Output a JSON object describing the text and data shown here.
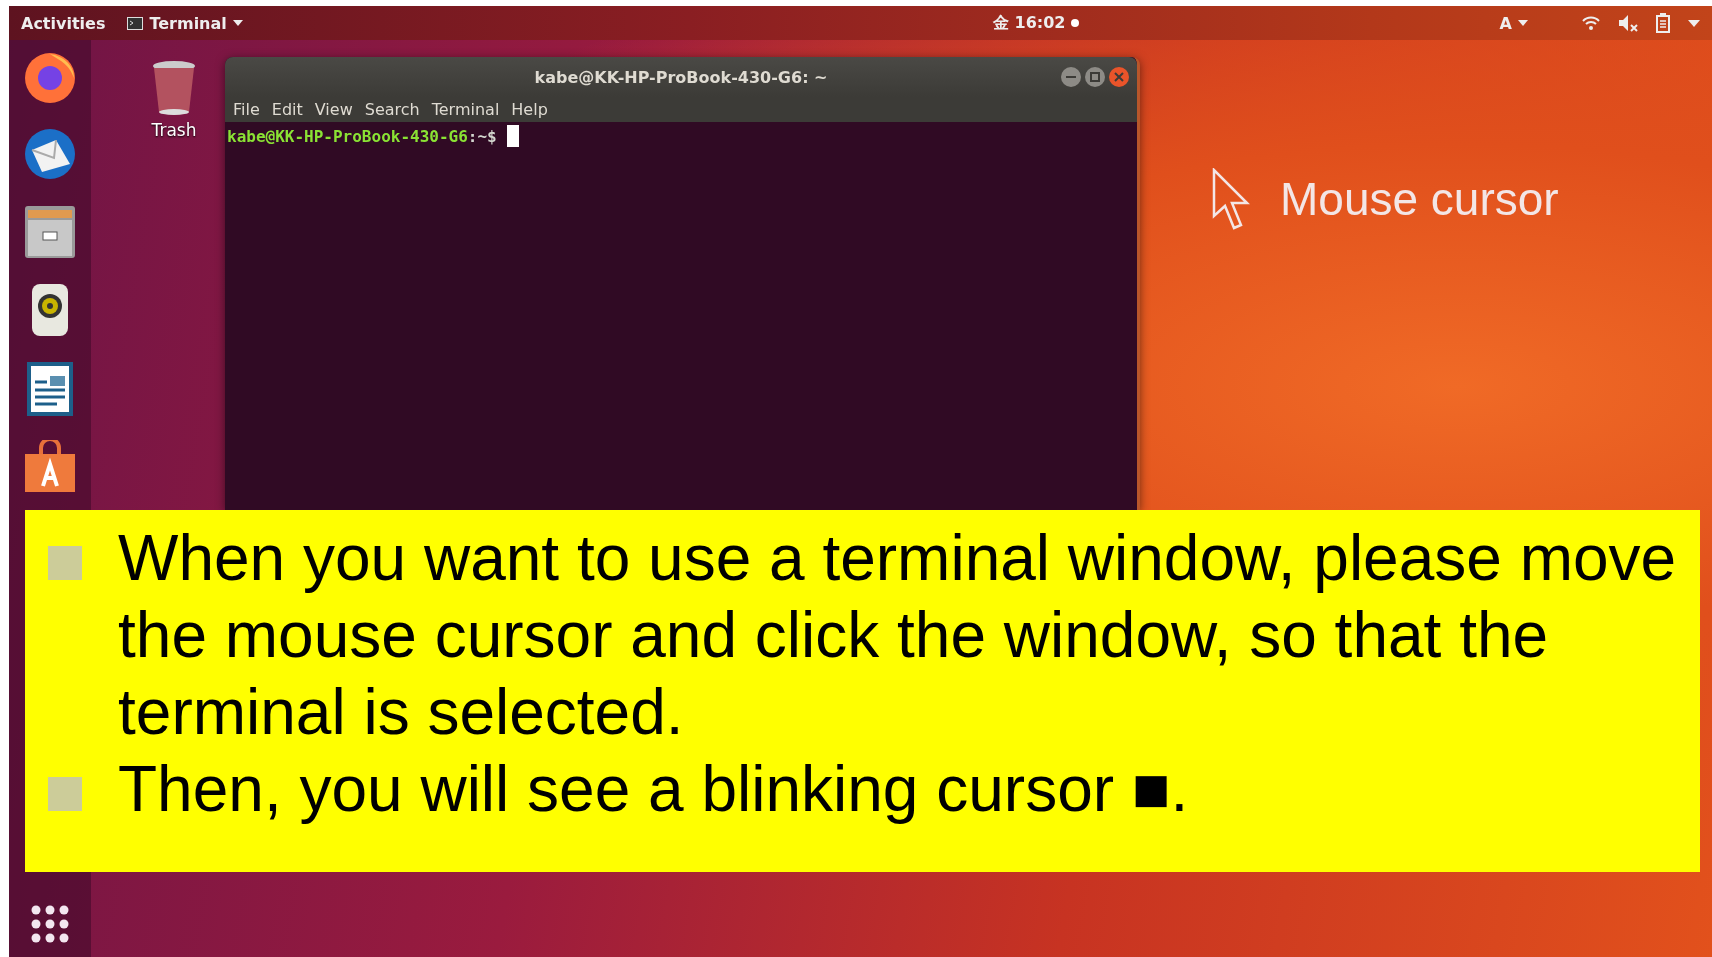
{
  "top_bar": {
    "activities": "Activities",
    "app_menu": "Terminal",
    "clock": "金 16:02",
    "input_source": "A"
  },
  "desktop": {
    "trash_label": "Trash"
  },
  "terminal": {
    "title": "kabe@KK-HP-ProBook-430-G6: ~",
    "menu": [
      "File",
      "Edit",
      "View",
      "Search",
      "Terminal",
      "Help"
    ],
    "prompt_user": "kabe@KK-HP-ProBook-430-G6",
    "prompt_path": ":~$"
  },
  "annotation": {
    "label": "Mouse cursor"
  },
  "callout": {
    "bullets": [
      "When you want to use a terminal window, please move the mouse cursor and click the window, so that the terminal is selected.",
      "Then, you will see a blinking cursor ■."
    ]
  }
}
